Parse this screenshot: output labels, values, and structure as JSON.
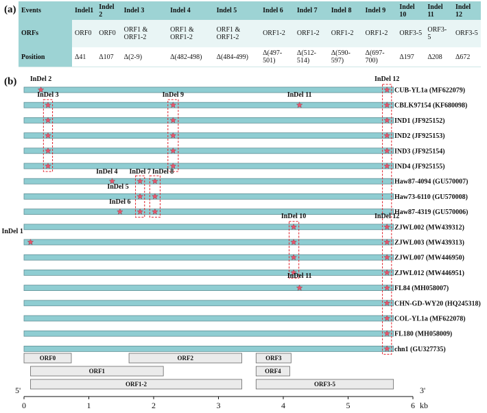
{
  "panel_a": {
    "label": "(a)",
    "headers": [
      "Events",
      "Indel1",
      "Indel 2",
      "Indel 3",
      "Indel 4",
      "Indel 5",
      "Indel 6",
      "Indel 7",
      "Indel 8",
      "Indel 9",
      "Indel 10",
      "Indel 11",
      "Indel 12"
    ],
    "rows": [
      {
        "head": "ORFs",
        "cells": [
          "ORF0",
          "ORF0",
          "ORF1 & ORF1-2",
          "ORF1 & ORF1-2",
          "ORF1 & ORF1-2",
          "ORF1-2",
          "ORF1-2",
          "ORF1-2",
          "ORF1-2",
          "ORF3-5",
          "ORF3-5",
          "ORF3-5"
        ]
      },
      {
        "head": "Position",
        "cells": [
          "Δ41",
          "Δ107",
          "Δ(2-9)",
          "Δ(482-498)",
          "Δ(484-499)",
          "Δ(497-501)",
          "Δ(512-514)",
          "Δ(590-597)",
          "Δ(697-700)",
          "Δ197",
          "Δ208",
          "Δ672"
        ]
      }
    ]
  },
  "panel_b": {
    "label": "(b)",
    "genomes": [
      "CUB-YL1a (MF622079)",
      "CBLK97154 (KF680098)",
      "IND1 (JF925152)",
      "IND2 (JF925153)",
      "IND3 (JF925154)",
      "IND4 (JF925155)",
      "Haw87-4094 (GU570007)",
      "Haw73-6110 (GU570008)",
      "Haw87-4319 (GU570006)",
      "ZJWL002 (MW439312)",
      "ZJWL003 (MW439313)",
      "ZJWL007 (MW446950)",
      "ZJWL012 (MW446951)",
      "FL84 (MH058007)",
      "CHN-GD-WY20 (HQ245318)",
      "COL-YL1a (MF622078)",
      "FL180 (MH058009)",
      "chn1 (GU327735)"
    ],
    "genome_length_kb": 5.7,
    "indel_labels": [
      {
        "text": "InDel 2",
        "kb": 0.26
      },
      {
        "text": "InDel 12",
        "kb": 5.6
      },
      {
        "text": "InDel 3",
        "kb": 0.37
      },
      {
        "text": "InDel 9",
        "kb": 2.3
      },
      {
        "text": "InDel 11",
        "kb": 4.25
      },
      {
        "text": "InDel 4",
        "kb": 1.36
      },
      {
        "text": "InDel 7",
        "kb": 1.79
      },
      {
        "text": "InDel 8",
        "kb": 2.02
      },
      {
        "text": "InDel 5",
        "kb": 1.45
      },
      {
        "text": "InDel 6",
        "kb": 1.48
      },
      {
        "text": "InDel 10",
        "kb": 4.16
      },
      {
        "text": "InDel 12",
        "kb": 5.6
      },
      {
        "text": "InDel 1",
        "kb": 0.1
      },
      {
        "text": "InDel 11",
        "kb": 4.25
      }
    ],
    "stars": [
      [
        0.26,
        5.6
      ],
      [
        0.37,
        2.3,
        4.25,
        5.6
      ],
      [
        0.37,
        2.3,
        5.6
      ],
      [
        0.37,
        2.3,
        5.6
      ],
      [
        0.37,
        2.3,
        5.6
      ],
      [
        0.37,
        2.3,
        5.6
      ],
      [
        1.36,
        1.79,
        2.02
      ],
      [
        1.79,
        2.02
      ],
      [
        1.48,
        1.79,
        2.02
      ],
      [
        4.16,
        5.6
      ],
      [
        0.1,
        4.16,
        5.6
      ],
      [
        4.16,
        5.6
      ],
      [
        4.16,
        5.6
      ],
      [
        4.25,
        5.6
      ],
      [
        5.6
      ],
      [
        5.6
      ],
      [
        5.6
      ],
      [
        5.6
      ]
    ],
    "orfs": [
      {
        "name": "ORF0",
        "start_kb": 0.0,
        "end_kb": 0.73
      },
      {
        "name": "ORF2",
        "start_kb": 1.62,
        "end_kb": 3.36
      },
      {
        "name": "ORF3",
        "start_kb": 3.58,
        "end_kb": 4.12
      },
      {
        "name": "ORF1",
        "start_kb": 0.1,
        "end_kb": 2.15
      },
      {
        "name": "ORF4",
        "start_kb": 3.58,
        "end_kb": 4.1
      },
      {
        "name": "ORF1-2",
        "start_kb": 0.1,
        "end_kb": 3.36
      },
      {
        "name": "ORF3-5",
        "start_kb": 3.58,
        "end_kb": 5.7
      }
    ],
    "axis": {
      "ticks": [
        "0",
        "1",
        "2",
        "3",
        "4",
        "5",
        "6"
      ],
      "unit": "kb",
      "five_prime": "5'",
      "three_prime": "3'"
    },
    "colors": {
      "bar": "#8fcdd2",
      "star": "#e8556c",
      "box": "#e0202a"
    }
  }
}
